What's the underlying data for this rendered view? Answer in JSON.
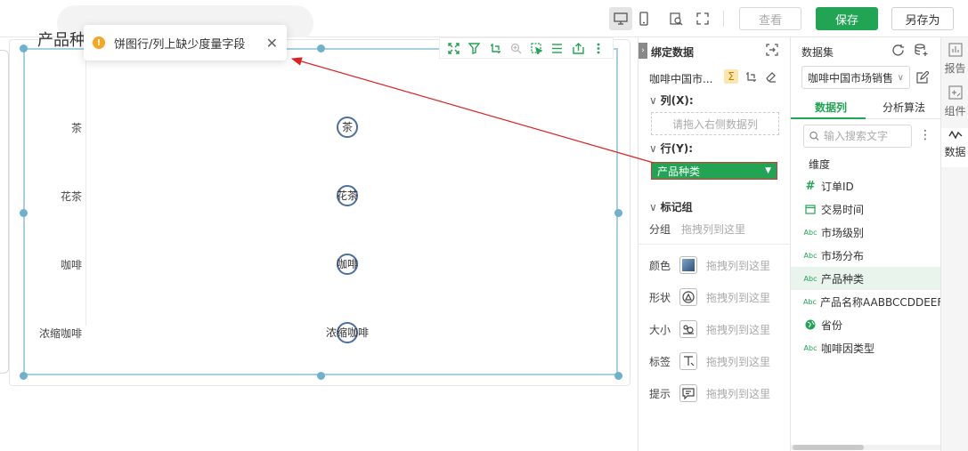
{
  "toolbar": {
    "view_label": "查看",
    "save_label": "保存",
    "save_as_label": "另存为"
  },
  "toast": {
    "message": "饼图行/列上缺少度量字段",
    "close": "✕",
    "warn_glyph": "!"
  },
  "chart": {
    "title": "产品种类",
    "chart_data": {
      "type": "scatter",
      "categories": [
        "茶",
        "花茶",
        "咖啡",
        "浓缩咖啡"
      ],
      "values": [
        1,
        1,
        1,
        1
      ]
    }
  },
  "binding": {
    "title": "绑定数据",
    "dataset_short": "咖啡中国市...",
    "columns_title": "列(X):",
    "columns_placeholder": "请拖入右侧数据列",
    "rows_title": "行(Y):",
    "row_field": "产品种类",
    "marks_title": "标记组",
    "group_label": "分组",
    "drop_hint": "拖拽列到这里",
    "marks": [
      {
        "label": "颜色",
        "hint": "拖拽列到这里",
        "icon": "color-icon"
      },
      {
        "label": "形状",
        "hint": "拖拽列到这里",
        "icon": "shape-icon"
      },
      {
        "label": "大小",
        "hint": "拖拽列到这里",
        "icon": "size-icon"
      },
      {
        "label": "标签",
        "hint": "拖拽列到这里",
        "icon": "label-icon"
      },
      {
        "label": "提示",
        "hint": "拖拽列到这里",
        "icon": "tooltip-icon"
      }
    ]
  },
  "dataset": {
    "title": "数据集",
    "selected": "咖啡中国市场销售",
    "tabs": [
      "数据列",
      "分析算法"
    ],
    "search_placeholder": "输入搜索文字",
    "dimension_label": "维度",
    "fields": [
      {
        "name": "订单ID",
        "type": "#"
      },
      {
        "name": "交易时间",
        "type": "date"
      },
      {
        "name": "市场级别",
        "type": "Abc"
      },
      {
        "name": "市场分布",
        "type": "Abc"
      },
      {
        "name": "产品种类",
        "type": "Abc"
      },
      {
        "name": "产品名称AABBCCDDEEFF",
        "type": "Abc"
      },
      {
        "name": "省份",
        "type": "geo"
      },
      {
        "name": "咖啡因类型",
        "type": "Abc"
      }
    ]
  },
  "rail": [
    {
      "label": "报告"
    },
    {
      "label": "组件"
    },
    {
      "label": "数据"
    }
  ],
  "colors": {
    "accent": "#21a554",
    "frame": "#a7cfe0",
    "point": "#4a6fa0",
    "arrow": "#e02020",
    "warning": "#f5a623"
  }
}
